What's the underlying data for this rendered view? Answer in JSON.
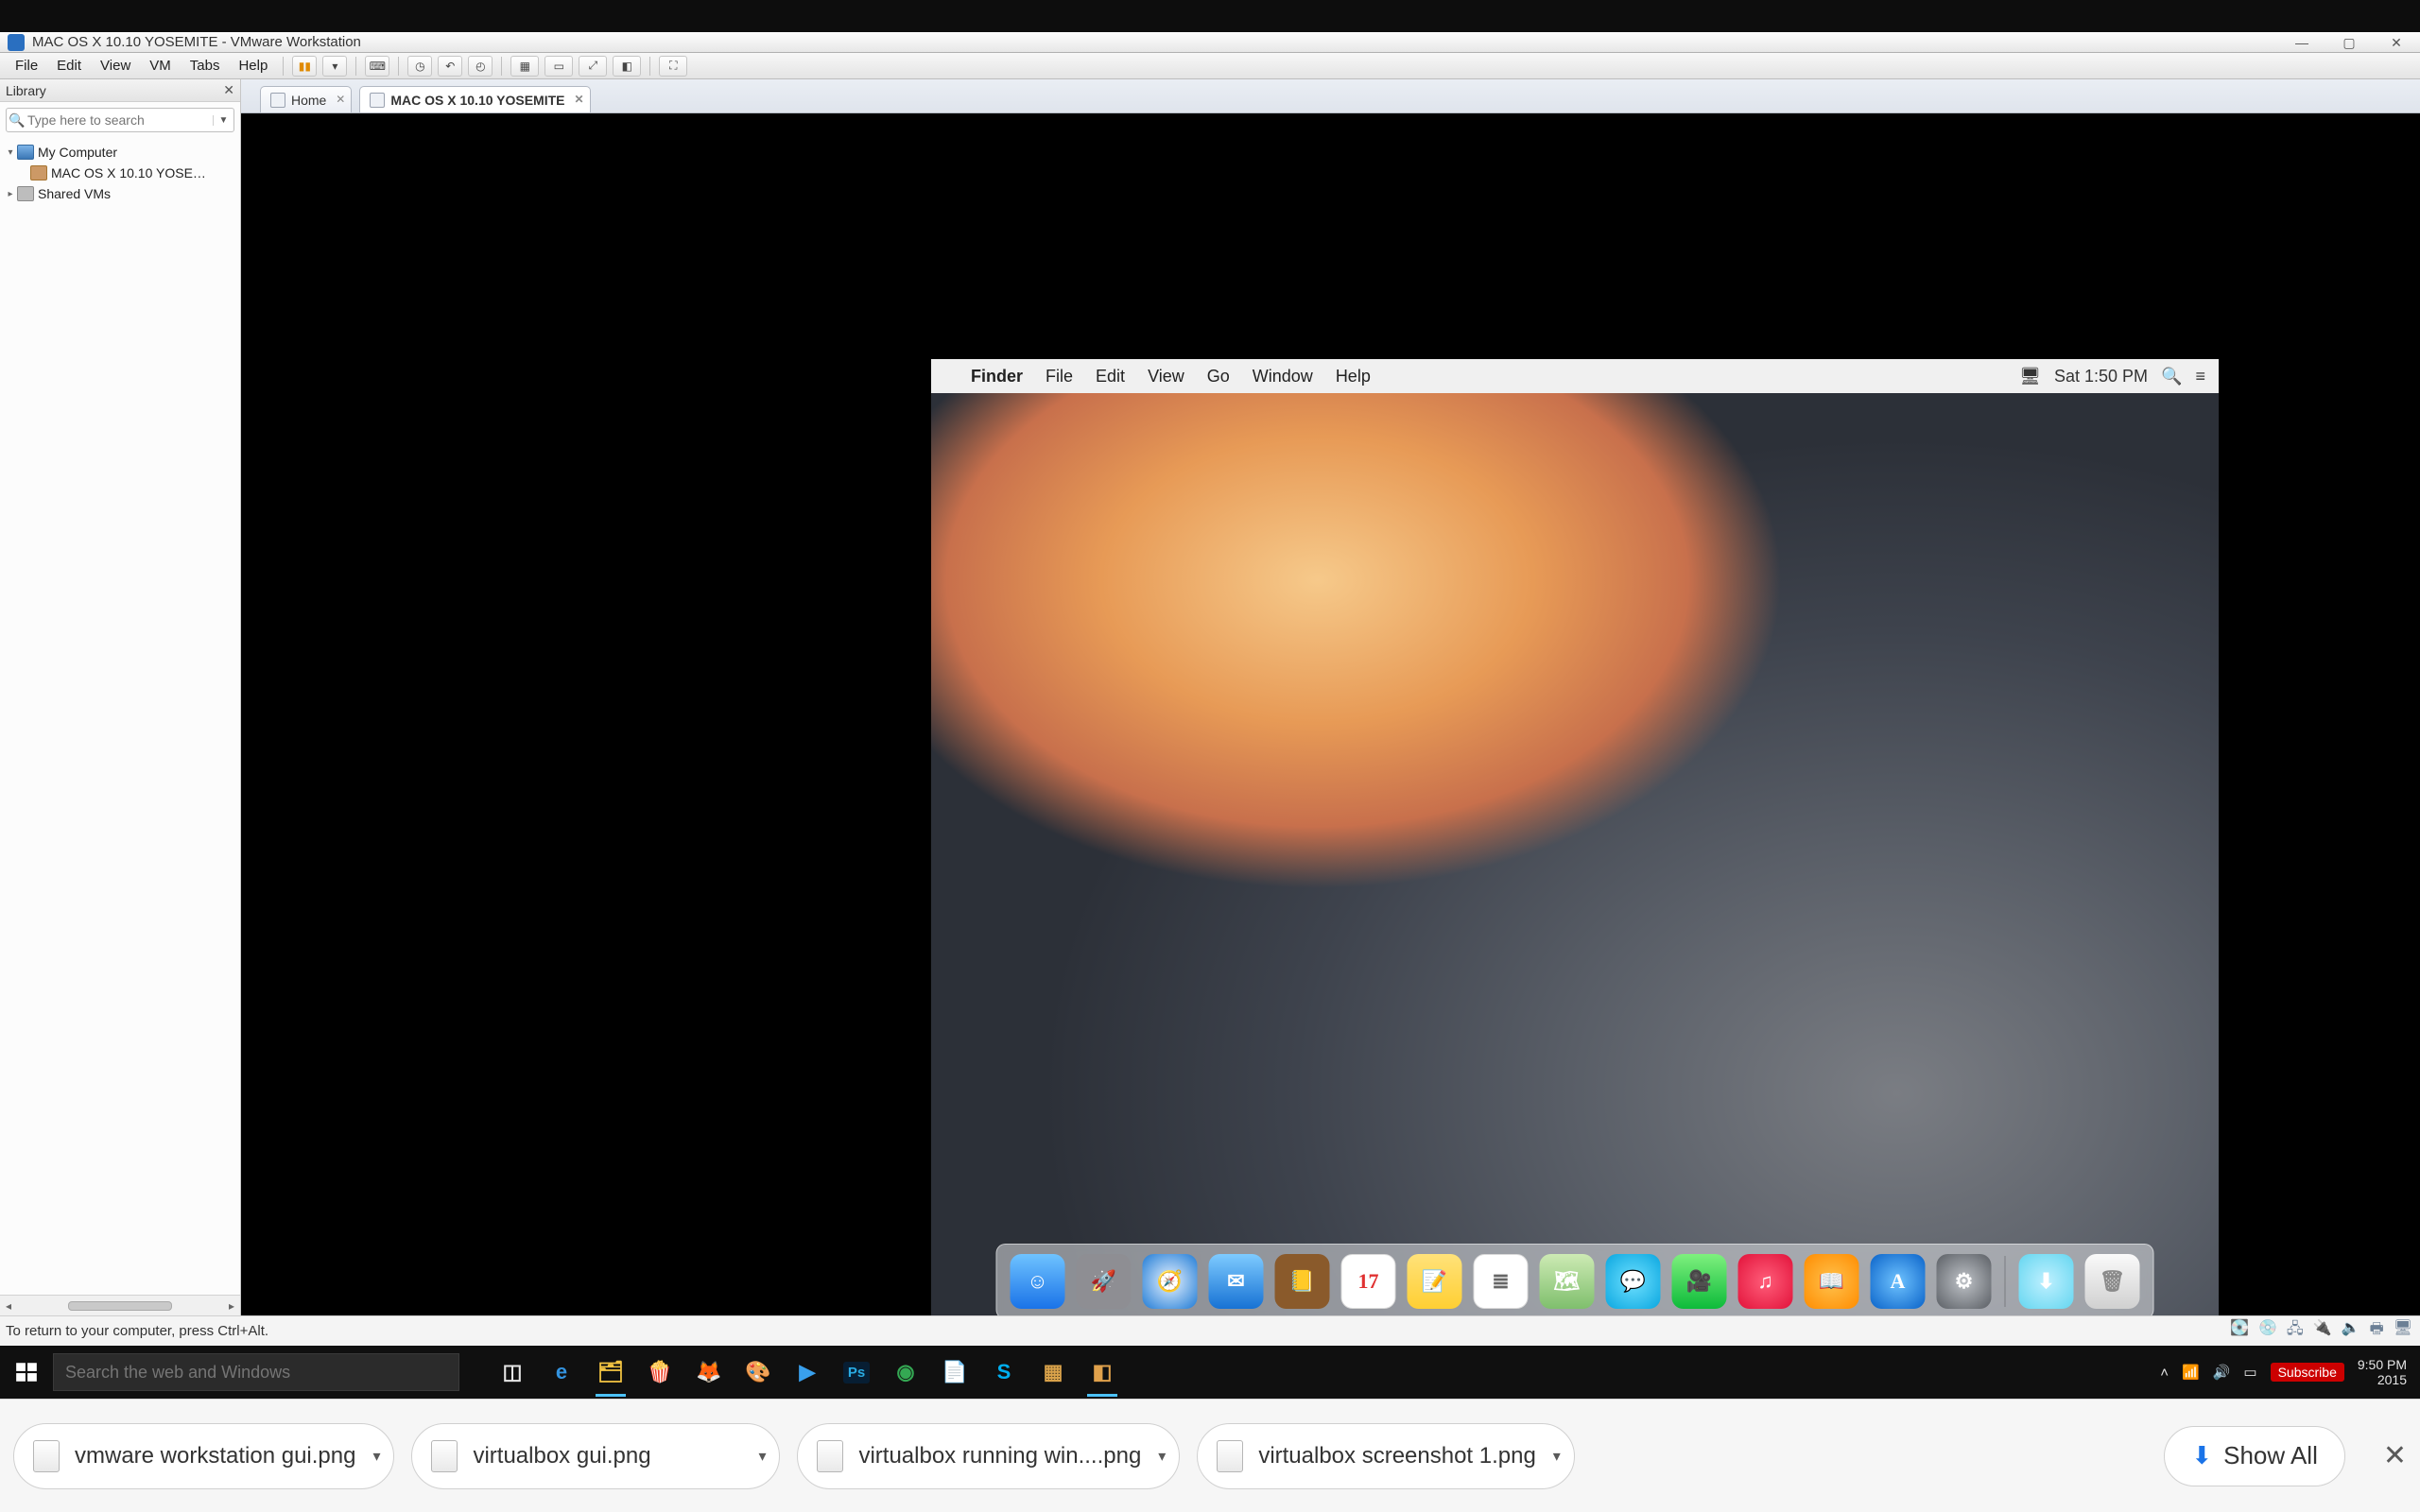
{
  "vmware": {
    "title": "MAC OS X 10.10 YOSEMITE - VMware Workstation",
    "menus": [
      "File",
      "Edit",
      "View",
      "VM",
      "Tabs",
      "Help"
    ],
    "library": {
      "title": "Library",
      "search_placeholder": "Type here to search",
      "items": {
        "root": "My Computer",
        "vm": "MAC OS X 10.10 YOSE…",
        "shared": "Shared VMs"
      }
    },
    "tabs": {
      "home": "Home",
      "active": "MAC OS X 10.10 YOSEMITE"
    },
    "status_hint": "To return to your computer, press Ctrl+Alt."
  },
  "mac": {
    "menubar": {
      "app": "Finder",
      "items": [
        "File",
        "Edit",
        "View",
        "Go",
        "Window",
        "Help"
      ],
      "clock": "Sat 1:50 PM"
    },
    "dock": [
      {
        "name": "finder",
        "bg": "linear-gradient(#6fc3ff,#1a73e8)",
        "glyph": "☺"
      },
      {
        "name": "launchpad",
        "bg": "#8e8e93",
        "glyph": "🚀"
      },
      {
        "name": "safari",
        "bg": "radial-gradient(#eaf4ff,#1f7bd6)",
        "glyph": "🧭"
      },
      {
        "name": "mail",
        "bg": "linear-gradient(#7ecbff,#1772d4)",
        "glyph": "✉"
      },
      {
        "name": "contacts",
        "bg": "#8a5a2b",
        "glyph": "📒"
      },
      {
        "name": "calendar",
        "bg": "#fff",
        "glyph": "17",
        "text": "#e03131",
        "border": "1px solid #d9d9d9"
      },
      {
        "name": "notes",
        "bg": "linear-gradient(#ffe27a,#ffcf33)",
        "glyph": "📝"
      },
      {
        "name": "reminders",
        "bg": "#fff",
        "glyph": "≣",
        "text": "#666",
        "border": "1px solid #d9d9d9"
      },
      {
        "name": "maps",
        "bg": "linear-gradient(#cdeab4,#7fbf6d)",
        "glyph": "🗺"
      },
      {
        "name": "messages",
        "bg": "radial-gradient(#6fe0ff,#0aa7e0)",
        "glyph": "💬"
      },
      {
        "name": "facetime",
        "bg": "linear-gradient(#7ef07e,#0dbb3a)",
        "glyph": "🎥"
      },
      {
        "name": "itunes",
        "bg": "radial-gradient(#ff5e7a,#e2123a)",
        "glyph": "♫"
      },
      {
        "name": "ibooks",
        "bg": "radial-gradient(#ffc24d,#ff8c00)",
        "glyph": "📖"
      },
      {
        "name": "appstore",
        "bg": "radial-gradient(#6fc3ff,#0a63c9)",
        "glyph": "A"
      },
      {
        "name": "preferences",
        "bg": "radial-gradient(#bfc3c8,#5a5e64)",
        "glyph": "⚙"
      }
    ],
    "dock_right": [
      {
        "name": "downloads",
        "bg": "radial-gradient(#bff0ff,#64d6f0)",
        "glyph": "⬇"
      },
      {
        "name": "trash",
        "bg": "linear-gradient(#fafafa,#d0d0d0)",
        "glyph": "🗑",
        "text": "#8a8a8a"
      }
    ]
  },
  "taskbar": {
    "search_placeholder": "Search the web and Windows",
    "apps": [
      {
        "name": "task-view",
        "glyph": "◫",
        "color": "#e6e6e6"
      },
      {
        "name": "edge",
        "glyph": "e",
        "color": "#3393df",
        "active": false
      },
      {
        "name": "file-explorer",
        "glyph": "🗂",
        "color": "#f4c542",
        "active": true
      },
      {
        "name": "popcorn",
        "glyph": "🍿",
        "color": "#c94f4f"
      },
      {
        "name": "firefox",
        "glyph": "🦊",
        "color": "#ff7139"
      },
      {
        "name": "gimp",
        "glyph": "🎨",
        "color": "#cba96e"
      },
      {
        "name": "media-player",
        "glyph": "▶",
        "color": "#39a0ed"
      },
      {
        "name": "photoshop",
        "glyph": "Ps",
        "color": "#29abe2",
        "bg": "#071e33"
      },
      {
        "name": "chrome",
        "glyph": "◉",
        "color": "#34a853"
      },
      {
        "name": "notepad",
        "glyph": "📄",
        "color": "#8fb6d9"
      },
      {
        "name": "skype",
        "glyph": "S",
        "color": "#00aff0"
      },
      {
        "name": "vmware",
        "glyph": "▦",
        "color": "#d9a24a",
        "active": false
      },
      {
        "name": "app",
        "glyph": "◧",
        "color": "#e0a14b",
        "active": true
      }
    ],
    "tray": {
      "chevron": "˄",
      "wifi": "📶",
      "sound": "🔊",
      "dnd": "▭",
      "subscribe": "Subscribe",
      "time": "9:50 PM",
      "date": "2015"
    }
  },
  "downloads": {
    "items": [
      "vmware workstation gui.png",
      "virtualbox gui.png",
      "virtualbox running win....png",
      "virtualbox screenshot 1.png"
    ],
    "show_all": "Show All"
  }
}
